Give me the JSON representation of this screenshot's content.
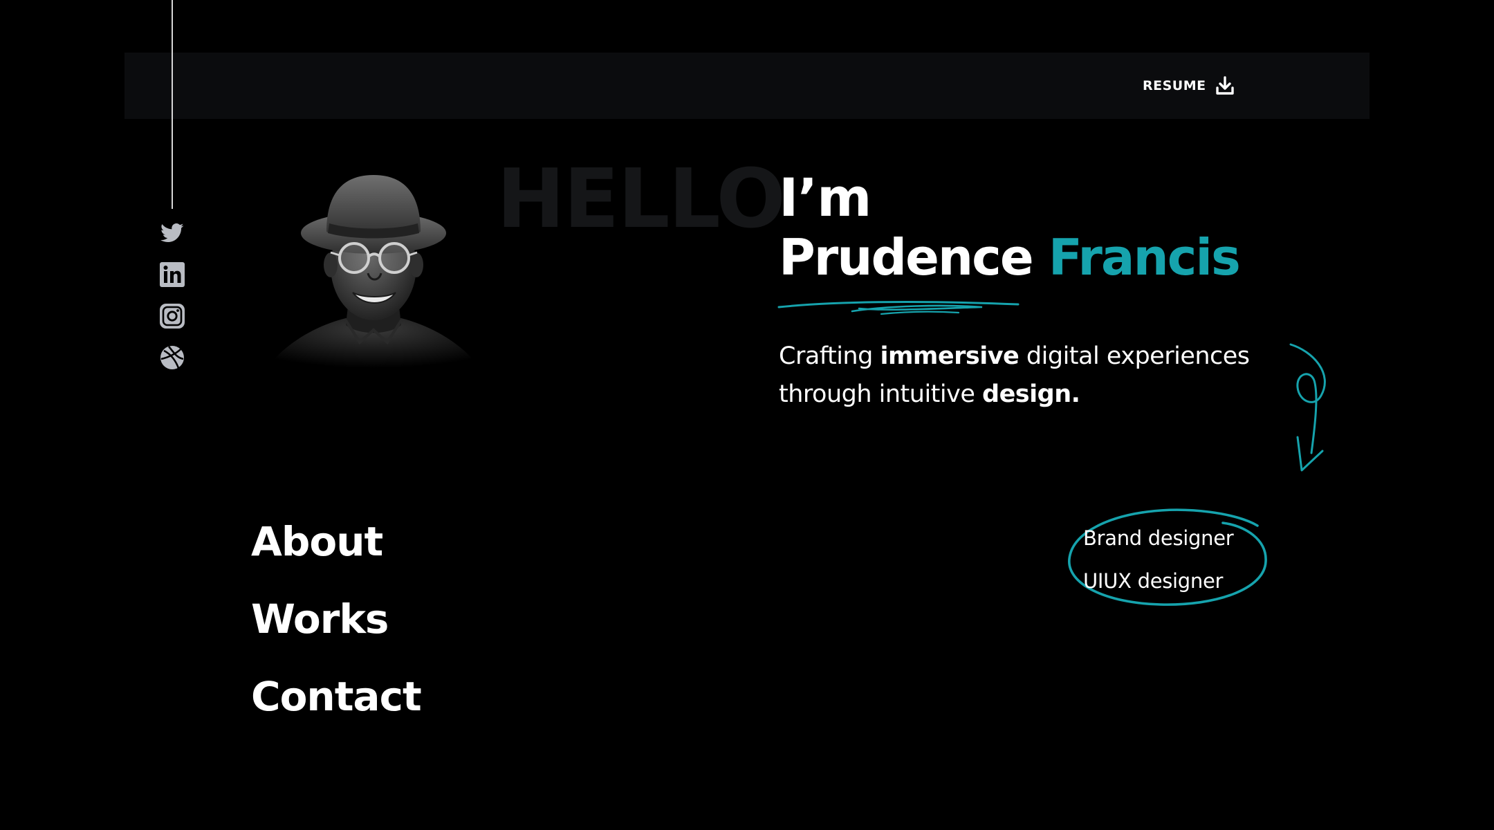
{
  "header": {
    "resume_label": "RESUME",
    "resume_icon": "download-icon"
  },
  "social": [
    {
      "name": "twitter",
      "icon": "twitter-icon"
    },
    {
      "name": "linkedin",
      "icon": "linkedin-icon"
    },
    {
      "name": "instagram",
      "icon": "instagram-icon"
    },
    {
      "name": "dribbble",
      "icon": "dribbble-icon"
    }
  ],
  "hero": {
    "background_word": "HELLO",
    "greeting": "I’m",
    "first_name": "Prudence",
    "last_name": "Francis",
    "tagline": {
      "part1": "Crafting ",
      "bold1": "immersive",
      "part2": " digital experiences through intuitive ",
      "bold2": "design."
    }
  },
  "nav": {
    "about": "About",
    "works": "Works",
    "contact": "Contact"
  },
  "roles": [
    "Brand designer",
    "UIUX designer"
  ],
  "colors": {
    "background": "#000000",
    "topbar": "#0b0c0e",
    "accent": "#16a3ad",
    "text": "#ffffff",
    "icon": "#b9bcc3"
  }
}
